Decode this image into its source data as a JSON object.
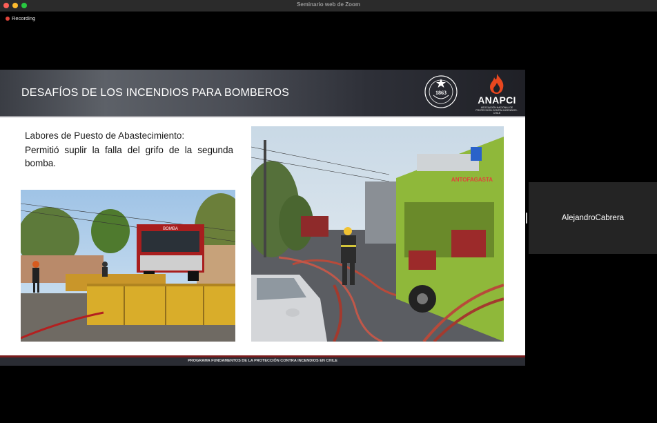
{
  "window": {
    "title": "Seminario web de Zoom"
  },
  "recording": {
    "label": "Recording",
    "color": "#e0443a"
  },
  "slide": {
    "title": "DESAFÍOS DE LOS INCENDIOS PARA BOMBEROS",
    "seal_year": "1863",
    "logo": {
      "name": "ANAPCI",
      "tagline": "ASOCIACIÓN NACIONAL DE PROTECCIÓN CONTRA INCENDIOS - CHILE",
      "flame_color": "#e8471f"
    },
    "heading": "Labores de Puesto de Abastecimiento:",
    "body": "Permitió suplir la falla del grifo de la segunda bomba.",
    "photo_left": {
      "truck_text": "BOMBA"
    },
    "photo_right": {
      "truck_text": "ANTOFAGASTA"
    },
    "footer": "PROGRAMA FUNDAMENTOS DE LA PROTECCIÓN CONTRA INCENDIOS EN CHILE"
  },
  "participant": {
    "name": "AlejandroCabrera"
  },
  "colors": {
    "accent_red": "#e0443a",
    "truck_green": "#8fb83a",
    "tank_yellow": "#d9ad2a"
  }
}
